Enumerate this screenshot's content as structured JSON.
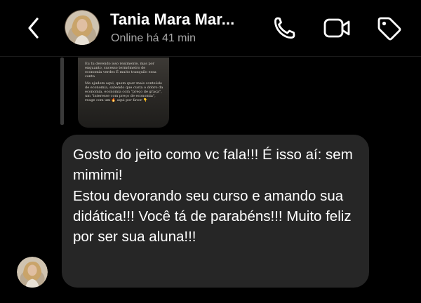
{
  "header": {
    "contact_name": "Tania Mara Mar...",
    "status": "Online há 41 min",
    "back_icon": "chevron-left-icon",
    "call_icon": "phone-icon",
    "video_icon": "video-camera-icon",
    "tag_icon": "tag-icon"
  },
  "story_preview": {
    "paragraphs": [
      "Eu tu devendo isso realmente, mas por enquanto, sucesso termômetro de economia verdes  É  muito tranquilo essa conta",
      "Me ajudem aqui, quem quer mais conteúdo de economia, sabendo que custa o dobro da economia, economia com \"preço de graça\", um \"interesse com preço de economia\", reage com um 🔥 aqui por favor 👇"
    ]
  },
  "message": {
    "text": "Gosto do jeito como vc fala!!! É isso aí: sem mimimi!\nEstou devorando seu curso e amando sua didática!!! Você tá de parabéns!!! Muito feliz por ser sua aluna!!!"
  },
  "colors": {
    "background": "#000000",
    "bubble": "#262626",
    "status_text": "#a6a6a6"
  }
}
